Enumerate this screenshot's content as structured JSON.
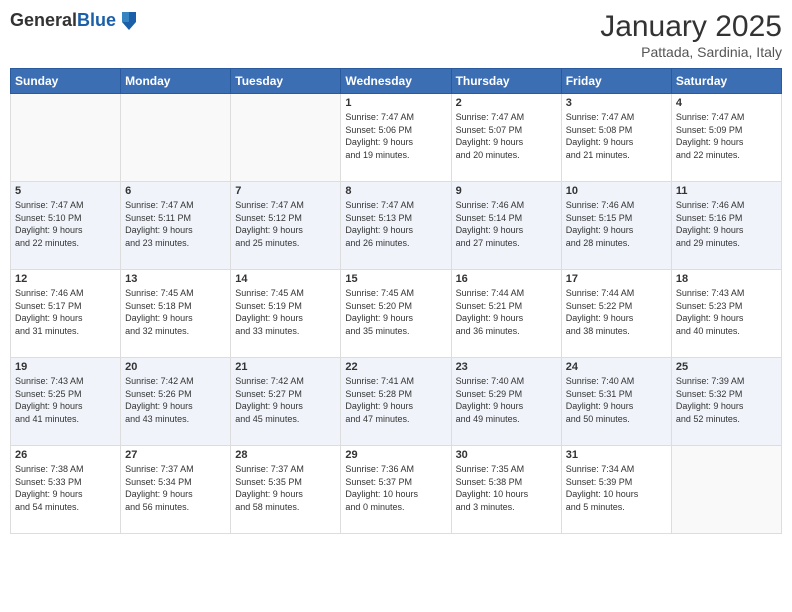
{
  "header": {
    "logo_general": "General",
    "logo_blue": "Blue",
    "month_title": "January 2025",
    "location": "Pattada, Sardinia, Italy"
  },
  "days_of_week": [
    "Sunday",
    "Monday",
    "Tuesday",
    "Wednesday",
    "Thursday",
    "Friday",
    "Saturday"
  ],
  "weeks": [
    [
      {
        "day": "",
        "info": ""
      },
      {
        "day": "",
        "info": ""
      },
      {
        "day": "",
        "info": ""
      },
      {
        "day": "1",
        "info": "Sunrise: 7:47 AM\nSunset: 5:06 PM\nDaylight: 9 hours\nand 19 minutes."
      },
      {
        "day": "2",
        "info": "Sunrise: 7:47 AM\nSunset: 5:07 PM\nDaylight: 9 hours\nand 20 minutes."
      },
      {
        "day": "3",
        "info": "Sunrise: 7:47 AM\nSunset: 5:08 PM\nDaylight: 9 hours\nand 21 minutes."
      },
      {
        "day": "4",
        "info": "Sunrise: 7:47 AM\nSunset: 5:09 PM\nDaylight: 9 hours\nand 22 minutes."
      }
    ],
    [
      {
        "day": "5",
        "info": "Sunrise: 7:47 AM\nSunset: 5:10 PM\nDaylight: 9 hours\nand 22 minutes."
      },
      {
        "day": "6",
        "info": "Sunrise: 7:47 AM\nSunset: 5:11 PM\nDaylight: 9 hours\nand 23 minutes."
      },
      {
        "day": "7",
        "info": "Sunrise: 7:47 AM\nSunset: 5:12 PM\nDaylight: 9 hours\nand 25 minutes."
      },
      {
        "day": "8",
        "info": "Sunrise: 7:47 AM\nSunset: 5:13 PM\nDaylight: 9 hours\nand 26 minutes."
      },
      {
        "day": "9",
        "info": "Sunrise: 7:46 AM\nSunset: 5:14 PM\nDaylight: 9 hours\nand 27 minutes."
      },
      {
        "day": "10",
        "info": "Sunrise: 7:46 AM\nSunset: 5:15 PM\nDaylight: 9 hours\nand 28 minutes."
      },
      {
        "day": "11",
        "info": "Sunrise: 7:46 AM\nSunset: 5:16 PM\nDaylight: 9 hours\nand 29 minutes."
      }
    ],
    [
      {
        "day": "12",
        "info": "Sunrise: 7:46 AM\nSunset: 5:17 PM\nDaylight: 9 hours\nand 31 minutes."
      },
      {
        "day": "13",
        "info": "Sunrise: 7:45 AM\nSunset: 5:18 PM\nDaylight: 9 hours\nand 32 minutes."
      },
      {
        "day": "14",
        "info": "Sunrise: 7:45 AM\nSunset: 5:19 PM\nDaylight: 9 hours\nand 33 minutes."
      },
      {
        "day": "15",
        "info": "Sunrise: 7:45 AM\nSunset: 5:20 PM\nDaylight: 9 hours\nand 35 minutes."
      },
      {
        "day": "16",
        "info": "Sunrise: 7:44 AM\nSunset: 5:21 PM\nDaylight: 9 hours\nand 36 minutes."
      },
      {
        "day": "17",
        "info": "Sunrise: 7:44 AM\nSunset: 5:22 PM\nDaylight: 9 hours\nand 38 minutes."
      },
      {
        "day": "18",
        "info": "Sunrise: 7:43 AM\nSunset: 5:23 PM\nDaylight: 9 hours\nand 40 minutes."
      }
    ],
    [
      {
        "day": "19",
        "info": "Sunrise: 7:43 AM\nSunset: 5:25 PM\nDaylight: 9 hours\nand 41 minutes."
      },
      {
        "day": "20",
        "info": "Sunrise: 7:42 AM\nSunset: 5:26 PM\nDaylight: 9 hours\nand 43 minutes."
      },
      {
        "day": "21",
        "info": "Sunrise: 7:42 AM\nSunset: 5:27 PM\nDaylight: 9 hours\nand 45 minutes."
      },
      {
        "day": "22",
        "info": "Sunrise: 7:41 AM\nSunset: 5:28 PM\nDaylight: 9 hours\nand 47 minutes."
      },
      {
        "day": "23",
        "info": "Sunrise: 7:40 AM\nSunset: 5:29 PM\nDaylight: 9 hours\nand 49 minutes."
      },
      {
        "day": "24",
        "info": "Sunrise: 7:40 AM\nSunset: 5:31 PM\nDaylight: 9 hours\nand 50 minutes."
      },
      {
        "day": "25",
        "info": "Sunrise: 7:39 AM\nSunset: 5:32 PM\nDaylight: 9 hours\nand 52 minutes."
      }
    ],
    [
      {
        "day": "26",
        "info": "Sunrise: 7:38 AM\nSunset: 5:33 PM\nDaylight: 9 hours\nand 54 minutes."
      },
      {
        "day": "27",
        "info": "Sunrise: 7:37 AM\nSunset: 5:34 PM\nDaylight: 9 hours\nand 56 minutes."
      },
      {
        "day": "28",
        "info": "Sunrise: 7:37 AM\nSunset: 5:35 PM\nDaylight: 9 hours\nand 58 minutes."
      },
      {
        "day": "29",
        "info": "Sunrise: 7:36 AM\nSunset: 5:37 PM\nDaylight: 10 hours\nand 0 minutes."
      },
      {
        "day": "30",
        "info": "Sunrise: 7:35 AM\nSunset: 5:38 PM\nDaylight: 10 hours\nand 3 minutes."
      },
      {
        "day": "31",
        "info": "Sunrise: 7:34 AM\nSunset: 5:39 PM\nDaylight: 10 hours\nand 5 minutes."
      },
      {
        "day": "",
        "info": ""
      }
    ]
  ]
}
